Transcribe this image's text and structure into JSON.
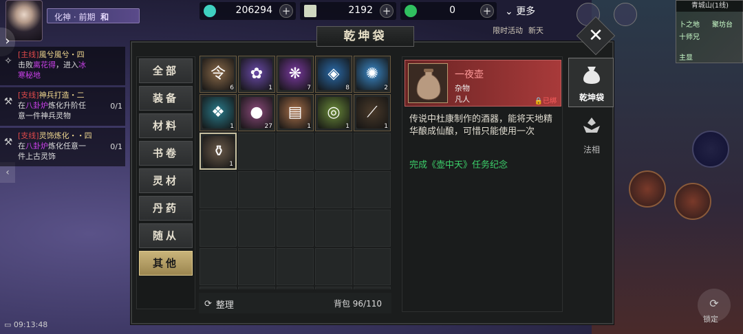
{
  "player": {
    "title": "化神 · 前期",
    "mode": "和"
  },
  "currencies": [
    {
      "icon": "jade-icon",
      "value": "206294",
      "color": "#3fd0c0"
    },
    {
      "icon": "token-icon",
      "value": "2192",
      "color": "#d0d8c0"
    },
    {
      "icon": "spirit-coin-icon",
      "value": "0",
      "color": "#30c060"
    }
  ],
  "top_menu": {
    "more": "更多",
    "events": [
      "限时活动",
      "新天"
    ]
  },
  "minimap": {
    "title": "青城山(1线)",
    "labels": [
      "卜之地",
      "十师兄",
      "聚坊台",
      "主显"
    ]
  },
  "quests": [
    {
      "tag": "[主线]",
      "title": "風兮風兮・四",
      "line2a": "击败",
      "line2hl": "离花得",
      "line2b": "，进入",
      "line2hl2": "冰",
      "line3": "寒秘地",
      "progress": ""
    },
    {
      "tag": "[支线]",
      "title": "神兵打造・二",
      "line2a": "在",
      "line2hl": "八卦炉",
      "line2b": "炼化升阶任",
      "line2hl2": "",
      "line3": "意一件神兵灵物",
      "progress": "0/1"
    },
    {
      "tag": "[支线]",
      "title": "灵饰炼化・・四",
      "line2a": "在",
      "line2hl": "八卦炉",
      "line2b": "炼化任意一",
      "line2hl2": "",
      "line3": "件上古灵饰",
      "progress": "0/1"
    }
  ],
  "status": {
    "time": "09:13:48"
  },
  "panel": {
    "title": "乾坤袋",
    "close": "✕"
  },
  "categories": [
    "全部",
    "装备",
    "材料",
    "书卷",
    "灵材",
    "丹药",
    "随从",
    "其他"
  ],
  "active_category": 7,
  "items": [
    {
      "name": "令牌",
      "count": "6",
      "color": "#8a6a4a",
      "glyph": "令"
    },
    {
      "name": "紫灵花",
      "count": "1",
      "color": "#6a4aa8",
      "glyph": "✿"
    },
    {
      "name": "紫气",
      "count": "7",
      "color": "#7a3aa0",
      "glyph": "❋"
    },
    {
      "name": "蓝晶",
      "count": "8",
      "color": "#2a6aa8",
      "glyph": "◈"
    },
    {
      "name": "蓝焰",
      "count": "2",
      "color": "#3a88c8",
      "glyph": "✺"
    },
    {
      "name": "卷轴",
      "count": "1",
      "color": "#2a7a8a",
      "glyph": "❖"
    },
    {
      "name": "灵珠",
      "count": "27",
      "color": "#8a4a7a",
      "glyph": "●"
    },
    {
      "name": "红帖",
      "count": "1",
      "color": "#a8704a",
      "glyph": "▤"
    },
    {
      "name": "灵汤",
      "count": "1",
      "color": "#6a8a3a",
      "glyph": "◎"
    },
    {
      "name": "钓竿",
      "count": "1",
      "color": "#4a3a2a",
      "glyph": "⟋"
    },
    {
      "name": "一夜壶",
      "count": "1",
      "color": "#6a5a4a",
      "glyph": "⚱"
    }
  ],
  "grid_footer": {
    "sort": "整理",
    "capacity": "背包 96/110"
  },
  "detail": {
    "name": "一夜壶",
    "type": "杂物",
    "grade": "凡人",
    "bound": "已绑",
    "description": "传说中杜康制作的酒器，能将天地精华酿成仙酿，可惜只能使用一次",
    "note": "完成《壶中天》任务纪念"
  },
  "right_tabs": [
    {
      "label": "乾坤袋",
      "icon": "bag-icon"
    },
    {
      "label": "法相",
      "icon": "dharma-icon"
    }
  ],
  "lock_button": "锁定"
}
